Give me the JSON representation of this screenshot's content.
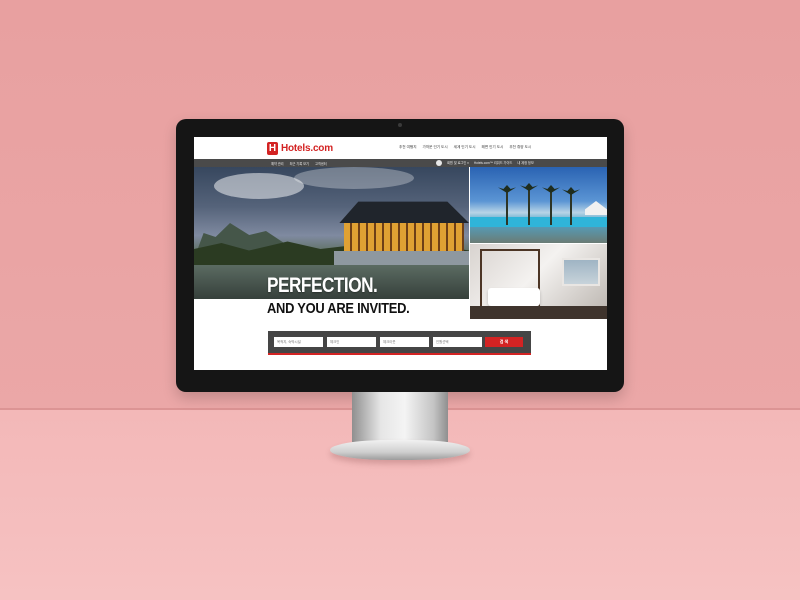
{
  "brand": {
    "logo_mark": "H",
    "name": "Hotels.com",
    "accent_color": "#d32323"
  },
  "nav": {
    "links": [
      "추천 여행지",
      "가까운 인기 도시",
      "세계 인기 도시",
      "해변 인기 도시",
      "추천 휴양 도시"
    ]
  },
  "subnav": {
    "left_items": [
      "예약 관리",
      "최근 기록 보기",
      "고객센터"
    ],
    "right_items": [
      "회원 및 로그인 ▾",
      "Hotels.com™ 리워드 가이드",
      "내 계정 정보"
    ]
  },
  "hero": {
    "headline_line1": "PERFECTION.",
    "headline_line2": "AND YOU ARE INVITED."
  },
  "search": {
    "destination_placeholder": "목적지, 숙박시설",
    "checkin_placeholder": "체크인",
    "checkout_placeholder": "체크아웃",
    "guests_placeholder": "인원선택",
    "button_label": "검 색"
  }
}
